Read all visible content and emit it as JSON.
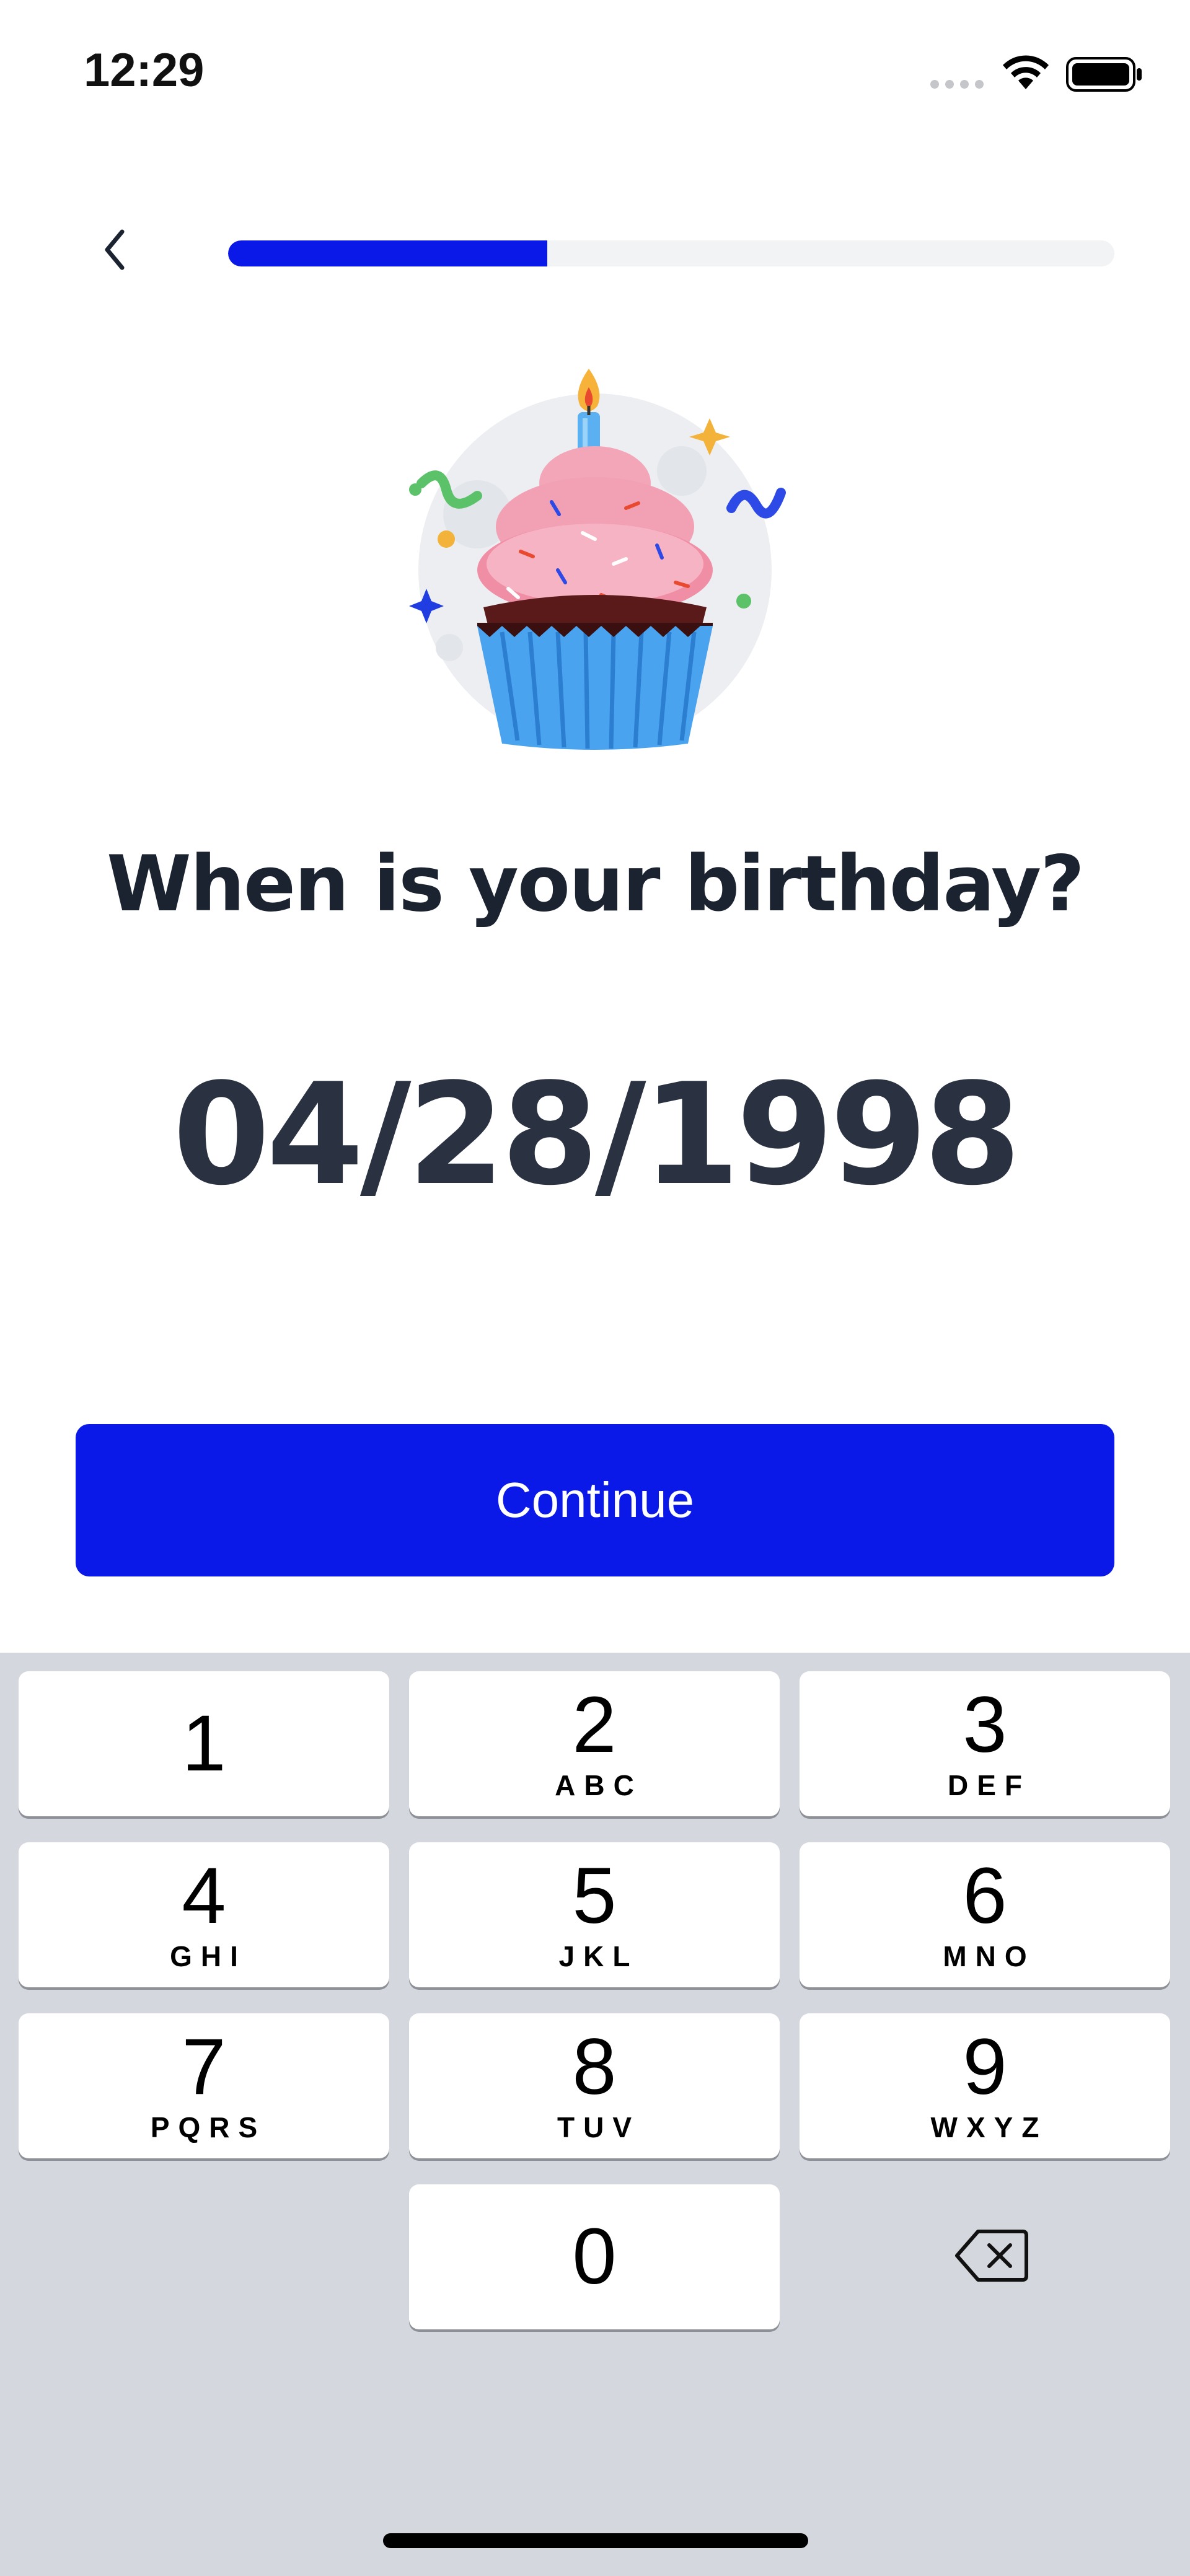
{
  "status_bar": {
    "time": "12:29",
    "icons": [
      "signal-icon",
      "wifi-icon",
      "battery-icon"
    ]
  },
  "nav": {
    "back_icon": "chevron-left-icon",
    "progress": 0.36
  },
  "illustration": {
    "icon": "birthday-cupcake-illustration"
  },
  "heading": "When is your birthday?",
  "date_value": "04/28/1998",
  "continue_label": "Continue",
  "colors": {
    "accent": "#0a18e8",
    "text_dark": "#1b2330",
    "keypad_bg": "#d4d7dd"
  },
  "keypad": {
    "keys": [
      {
        "digit": "1",
        "letters": ""
      },
      {
        "digit": "2",
        "letters": "ABC"
      },
      {
        "digit": "3",
        "letters": "DEF"
      },
      {
        "digit": "4",
        "letters": "GHI"
      },
      {
        "digit": "5",
        "letters": "JKL"
      },
      {
        "digit": "6",
        "letters": "MNO"
      },
      {
        "digit": "7",
        "letters": "PQRS"
      },
      {
        "digit": "8",
        "letters": "TUV"
      },
      {
        "digit": "9",
        "letters": "WXYZ"
      },
      {
        "digit": "0",
        "letters": ""
      }
    ],
    "backspace_icon": "backspace-icon"
  }
}
